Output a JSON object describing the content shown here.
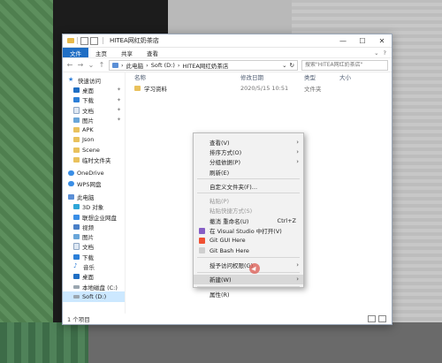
{
  "window": {
    "title": "HITEA网红奶茶店",
    "min_label": "—",
    "max_label": "☐",
    "close_label": "✕"
  },
  "ribbon": {
    "tabs": [
      "文件",
      "主页",
      "共享",
      "查看"
    ],
    "expand_label": "⌄",
    "help_label": "?"
  },
  "address": {
    "back": "←",
    "forward": "→",
    "recent": "⌄",
    "up": "↑",
    "path": [
      "此电脑",
      "Soft (D:)",
      "HITEA网红奶茶店"
    ],
    "separator": "›",
    "dropdown": "⌄",
    "refresh": "↻",
    "search_placeholder": "搜索\"HITEA网红奶茶店\""
  },
  "sidebar": {
    "quick_access": "快速访问",
    "items_pinned": [
      {
        "label": "桌面",
        "icon": "desktop-icon"
      },
      {
        "label": "下载",
        "icon": "download-icon"
      },
      {
        "label": "文档",
        "icon": "document-icon"
      },
      {
        "label": "图片",
        "icon": "pictures-icon"
      }
    ],
    "items_folders": [
      "APK",
      "Json",
      "Scene",
      "临时文件夹"
    ],
    "pin_glyph": "📌",
    "onedrive": "OneDrive",
    "wps": "WPS网盘",
    "this_pc": "此电脑",
    "pc_items": [
      {
        "label": "3D 对象",
        "icon": "3d-objects-icon"
      },
      {
        "label": "联想企业网盘",
        "icon": "lenovo-cloud-icon"
      },
      {
        "label": "视频",
        "icon": "videos-icon"
      },
      {
        "label": "图片",
        "icon": "pictures-icon"
      },
      {
        "label": "文档",
        "icon": "document-icon"
      },
      {
        "label": "下载",
        "icon": "download-icon"
      },
      {
        "label": "音乐",
        "icon": "music-icon"
      },
      {
        "label": "桌面",
        "icon": "desktop-icon"
      },
      {
        "label": "本地磁盘 (C:)",
        "icon": "drive-icon"
      },
      {
        "label": "Soft (D:)",
        "icon": "drive-icon"
      }
    ]
  },
  "columns": {
    "name": "名称",
    "date": "修改日期",
    "type": "类型",
    "size": "大小"
  },
  "rows": [
    {
      "name": "学习资料",
      "date": "2020/5/15 10:51",
      "type": "文件夹",
      "size": ""
    }
  ],
  "status": {
    "count": "1 个项目"
  },
  "context_menu": {
    "items_1": [
      {
        "label": "查看(V)",
        "arrow": "›"
      },
      {
        "label": "排序方式(O)",
        "arrow": "›"
      },
      {
        "label": "分组依据(P)",
        "arrow": "›"
      },
      {
        "label": "刷新(E)",
        "arrow": ""
      }
    ],
    "customize": "自定义文件夹(F)...",
    "items_2": [
      {
        "label": "粘贴(P)",
        "disabled": true,
        "shortcut": ""
      },
      {
        "label": "粘贴快捷方式(S)",
        "disabled": true,
        "shortcut": ""
      },
      {
        "label": "撤消 重命名(U)",
        "disabled": false,
        "shortcut": "Ctrl+Z"
      },
      {
        "label": "在 Visual Studio 中打开(V)",
        "disabled": false,
        "shortcut": ""
      },
      {
        "label": "Git GUI Here",
        "disabled": false,
        "shortcut": ""
      },
      {
        "label": "Git Bash Here",
        "disabled": false,
        "shortcut": ""
      }
    ],
    "grant_access": "授予访问权限(G)",
    "new": "新建(W)",
    "properties": "属性(R)",
    "arrow": "›"
  }
}
